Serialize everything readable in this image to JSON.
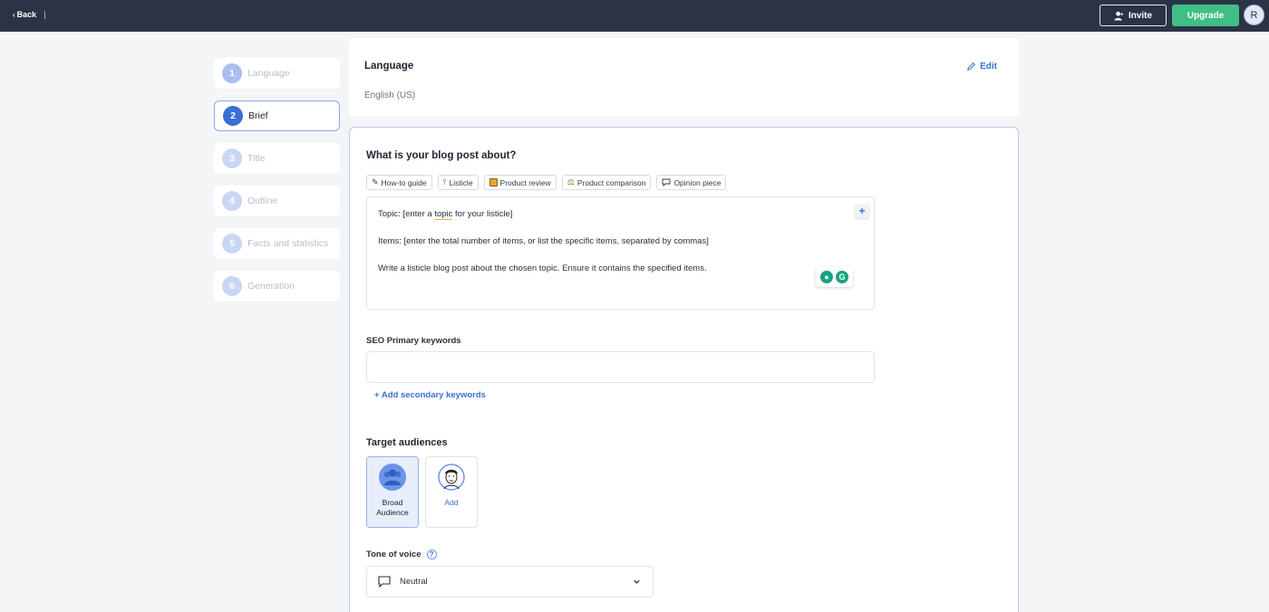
{
  "topbar": {
    "back_label": "Back",
    "separator": "|",
    "invite_label": "Invite",
    "upgrade_label": "Upgrade",
    "avatar_initial": "R"
  },
  "steps": [
    {
      "number": "1",
      "label": "Language"
    },
    {
      "number": "2",
      "label": "Brief"
    },
    {
      "number": "3",
      "label": "Title"
    },
    {
      "number": "4",
      "label": "Outline"
    },
    {
      "number": "5",
      "label": "Facts and statistics"
    },
    {
      "number": "6",
      "label": "Generation"
    }
  ],
  "language": {
    "title": "Language",
    "value": "English (US)",
    "edit_label": "Edit"
  },
  "brief": {
    "question": "What is your blog post about?",
    "templates": [
      {
        "icon": "pencil-icon",
        "label": "How-to guide"
      },
      {
        "icon": "pushpin-icon",
        "label": "Listicle"
      },
      {
        "icon": "package-icon",
        "label": "Product review"
      },
      {
        "icon": "scales-icon",
        "label": "Product comparison"
      },
      {
        "icon": "speech-bubble-icon",
        "label": "Opinion piece"
      }
    ],
    "prompt": {
      "line1_prefix": "Topic: [enter a ",
      "line1_highlight": "topic",
      "line1_suffix": " for your listicle]",
      "line2": "Items: [enter the total number of items, or list the specific items, separated by commas]",
      "line3": "Write a listicle blog post about the chosen topic. Ensure it contains the specified items.",
      "plus_label": "+"
    },
    "seo": {
      "label": "SEO Primary keywords",
      "value": "",
      "add_secondary_label": "+ Add secondary keywords"
    },
    "audiences": {
      "label": "Target audiences",
      "items": [
        {
          "label": "Broad Audience",
          "selected": true
        },
        {
          "label": "Add",
          "selected": false
        }
      ]
    },
    "tone": {
      "label": "Tone of voice",
      "help": "?",
      "value": "Neutral"
    }
  },
  "colors": {
    "topbar": "#2b3447",
    "accent": "#3b6ed8",
    "upgrade": "#3fbf85",
    "grammarly": "#15a37f"
  }
}
